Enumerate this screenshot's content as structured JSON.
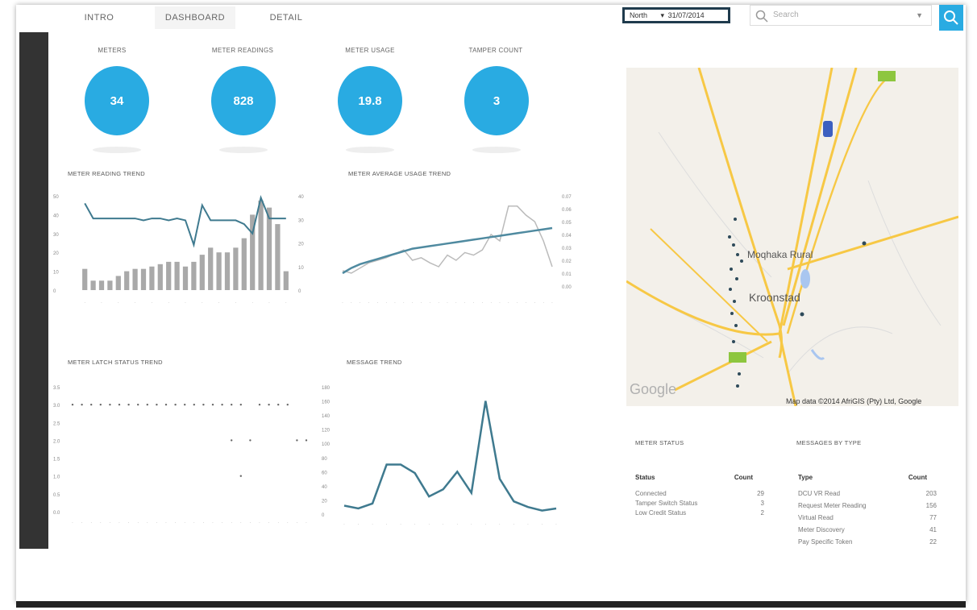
{
  "tabs": [
    {
      "label": "INTRO",
      "active": false
    },
    {
      "label": "DASHBOARD",
      "active": true
    },
    {
      "label": "DETAIL",
      "active": false
    }
  ],
  "filter": {
    "region": "North",
    "date": "31/07/2014"
  },
  "search": {
    "placeholder": "Search"
  },
  "kpis": [
    {
      "label": "METERS",
      "value": "34"
    },
    {
      "label": "METER READINGS",
      "value": "828"
    },
    {
      "label": "METER USAGE",
      "value": "19.8"
    },
    {
      "label": "TAMPER COUNT",
      "value": "3"
    }
  ],
  "charts": {
    "reading_trend_title": "METER READING TREND",
    "usage_trend_title": "METER AVERAGE USAGE TREND",
    "latch_trend_title": "METER LATCH STATUS TREND",
    "message_trend_title": "MESSAGE TREND"
  },
  "chart_data": [
    {
      "type": "bar",
      "title": "METER READING TREND",
      "bars": [
        9,
        4,
        4,
        4,
        6,
        8,
        9,
        9,
        10,
        11,
        12,
        12,
        10,
        12,
        15,
        18,
        16,
        16,
        18,
        22,
        32,
        38,
        35,
        28,
        8
      ],
      "line": [
        46,
        38,
        38,
        38,
        38,
        38,
        38,
        37,
        38,
        38,
        37,
        38,
        37,
        24,
        45,
        37,
        37,
        37,
        37,
        35,
        30,
        49,
        38,
        38,
        38
      ],
      "ylim_left": [
        0,
        50
      ],
      "ylim_right": [
        0,
        40
      ],
      "colors": {
        "bar": "#a9a9a9",
        "line": "#3f7a8f"
      }
    },
    {
      "type": "line",
      "title": "METER AVERAGE USAGE TREND",
      "actual": [
        0.012,
        0.01,
        0.014,
        0.018,
        0.02,
        0.022,
        0.025,
        0.028,
        0.02,
        0.022,
        0.018,
        0.015,
        0.024,
        0.02,
        0.026,
        0.024,
        0.028,
        0.04,
        0.035,
        0.062,
        0.062,
        0.055,
        0.05,
        0.035,
        0.015
      ],
      "trend": [
        0.01,
        0.014,
        0.017,
        0.019,
        0.021,
        0.023,
        0.025,
        0.027,
        0.029,
        0.03,
        0.031,
        0.032,
        0.033,
        0.034,
        0.035,
        0.036,
        0.037,
        0.038,
        0.039,
        0.04,
        0.041,
        0.042,
        0.043,
        0.044,
        0.045
      ],
      "ylim": [
        0,
        0.07
      ],
      "colors": {
        "actual": "#bbbbbb",
        "trend": "#4f8aa0"
      }
    },
    {
      "type": "scatter",
      "title": "METER LATCH STATUS TREND",
      "points": [
        [
          0,
          3
        ],
        [
          1,
          3
        ],
        [
          2,
          3
        ],
        [
          3,
          3
        ],
        [
          4,
          3
        ],
        [
          5,
          3
        ],
        [
          6,
          3
        ],
        [
          7,
          3
        ],
        [
          8,
          3
        ],
        [
          9,
          3
        ],
        [
          10,
          3
        ],
        [
          11,
          3
        ],
        [
          12,
          3
        ],
        [
          13,
          3
        ],
        [
          14,
          3
        ],
        [
          15,
          3
        ],
        [
          16,
          3
        ],
        [
          17,
          3
        ],
        [
          18,
          3
        ],
        [
          20,
          3
        ],
        [
          21,
          3
        ],
        [
          22,
          3
        ],
        [
          23,
          3
        ],
        [
          17,
          2
        ],
        [
          19,
          2
        ],
        [
          24,
          2
        ],
        [
          25,
          2
        ],
        [
          18,
          1
        ]
      ],
      "ylim": [
        0,
        3.5
      ],
      "color": "#666666"
    },
    {
      "type": "line",
      "title": "MESSAGE TREND",
      "values": [
        12,
        8,
        15,
        70,
        70,
        58,
        25,
        35,
        60,
        30,
        160,
        50,
        18,
        10,
        5,
        8
      ],
      "ylim": [
        0,
        180
      ],
      "color": "#3f7a8f"
    }
  ],
  "map": {
    "labels": [
      "Moqhaka Rural",
      "Kroonstad"
    ],
    "attribution": "Map data ©2014 AfriGIS (Pty) Ltd, Google",
    "logo": "Google"
  },
  "meter_status": {
    "title": "METER STATUS",
    "headers": [
      "Status",
      "Count"
    ],
    "rows": [
      [
        "Connected",
        "29"
      ],
      [
        "Tamper Switch Status",
        "3"
      ],
      [
        "Low Credit Status",
        "2"
      ]
    ]
  },
  "messages_by_type": {
    "title": "MESSAGES BY TYPE",
    "headers": [
      "Type",
      "Count"
    ],
    "rows": [
      [
        "DCU VR Read",
        "203"
      ],
      [
        "Request Meter Reading",
        "156"
      ],
      [
        "Virtual Read",
        "77"
      ],
      [
        "Meter Discovery",
        "41"
      ],
      [
        "Pay Specific Token",
        "22"
      ]
    ]
  }
}
